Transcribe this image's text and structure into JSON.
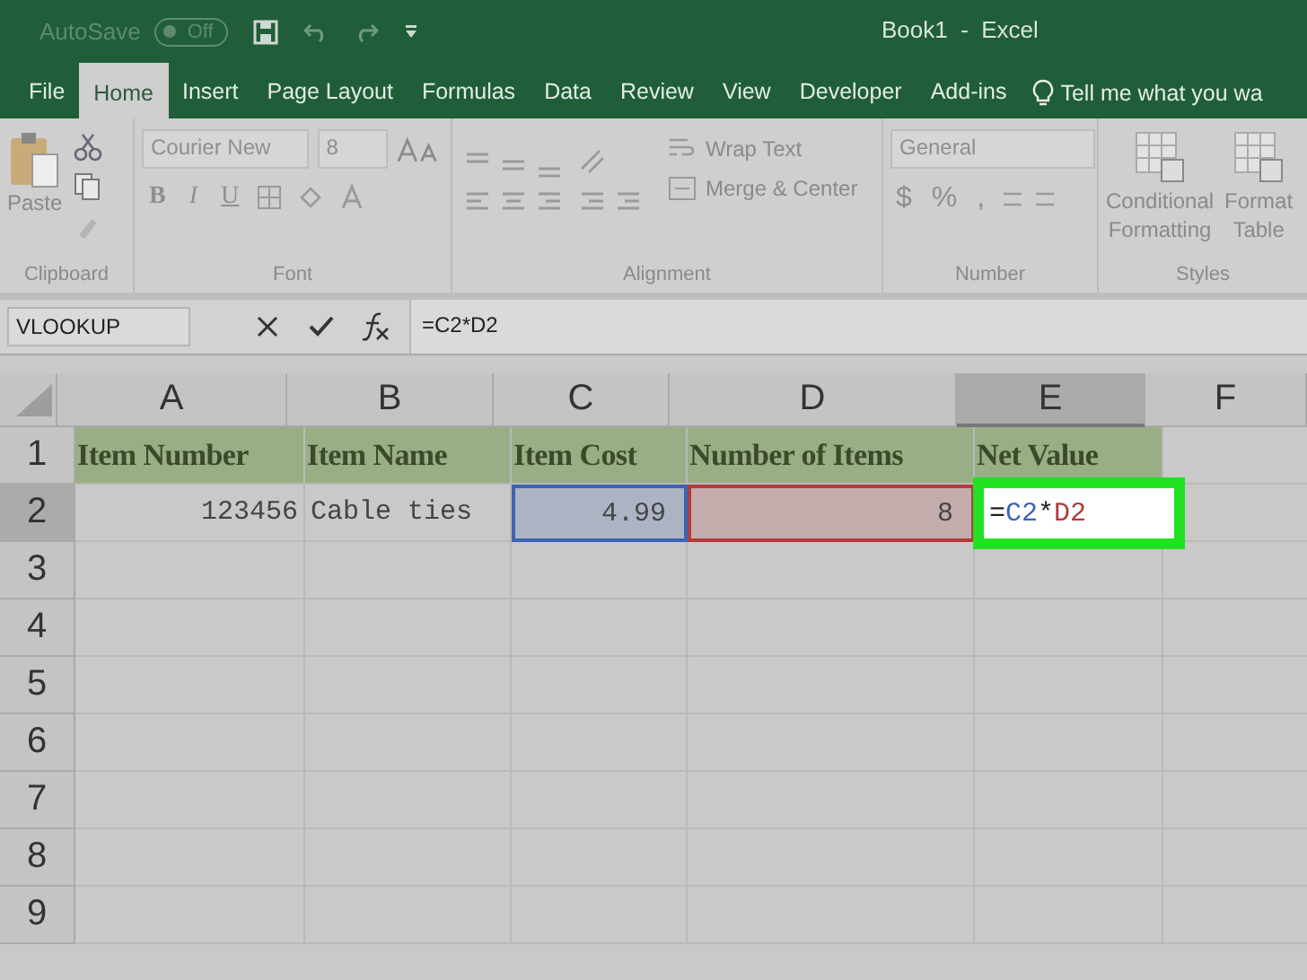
{
  "quick_access": {
    "autosave_label": "AutoSave",
    "autosave_toggle": {
      "label": "Off",
      "on": false
    }
  },
  "window": {
    "title": "Book1  -  Excel"
  },
  "tabs": [
    {
      "label": "File",
      "selected": false
    },
    {
      "label": "Home",
      "selected": true
    },
    {
      "label": "Insert",
      "selected": false
    },
    {
      "label": "Page Layout",
      "selected": false
    },
    {
      "label": "Formulas",
      "selected": false
    },
    {
      "label": "Data",
      "selected": false
    },
    {
      "label": "Review",
      "selected": false
    },
    {
      "label": "View",
      "selected": false
    },
    {
      "label": "Developer",
      "selected": false
    },
    {
      "label": "Add-ins",
      "selected": false
    }
  ],
  "tell_me": {
    "placeholder": "Tell me what you wa"
  },
  "ribbon": {
    "clipboard": {
      "paste": "Paste",
      "label": "Clipboard"
    },
    "font": {
      "name": "Courier New",
      "size": "8",
      "styles": [
        "B",
        "I",
        "U"
      ],
      "label": "Font"
    },
    "alignment": {
      "wrap": "Wrap Text",
      "merge": "Merge & Center",
      "label": "Alignment"
    },
    "number": {
      "format": "General",
      "symbols": [
        "$",
        "%",
        ","
      ],
      "label": "Number"
    },
    "styles": {
      "items": [
        {
          "lines": [
            "Conditional",
            "Formatting"
          ]
        },
        {
          "lines": [
            "Format",
            "Table"
          ]
        }
      ],
      "label": "Styles"
    }
  },
  "formula_bar": {
    "name_box": "VLOOKUP",
    "formula": "=C2*D2"
  },
  "sheet": {
    "columns": [
      {
        "label": "A",
        "selected": false
      },
      {
        "label": "B",
        "selected": false
      },
      {
        "label": "C",
        "selected": false
      },
      {
        "label": "D",
        "selected": false
      },
      {
        "label": "E",
        "selected": true
      },
      {
        "label": "F",
        "selected": false
      }
    ],
    "rows": [
      {
        "number": "1",
        "selected": false,
        "cells": [
          {
            "kind": "header",
            "text": "Item Number"
          },
          {
            "kind": "header",
            "text": "Item Name"
          },
          {
            "kind": "header",
            "text": "Item Cost"
          },
          {
            "kind": "header",
            "text": "Number of Items"
          },
          {
            "kind": "header",
            "text": "Net Value"
          },
          {
            "kind": "empty"
          }
        ]
      },
      {
        "number": "2",
        "selected": true,
        "cells": [
          {
            "kind": "number",
            "text": "123456"
          },
          {
            "kind": "text",
            "text": "Cable ties"
          },
          {
            "kind": "ref",
            "text": "4.99",
            "color": "#3b64b4"
          },
          {
            "kind": "ref",
            "text": "8",
            "color": "#b33a3a"
          },
          {
            "kind": "edit",
            "parts": [
              {
                "text": "=",
                "color": "#222222"
              },
              {
                "text": "C2",
                "color": "#3b64b4"
              },
              {
                "text": "*",
                "color": "#222222"
              },
              {
                "text": "D2",
                "color": "#b33a3a"
              }
            ]
          },
          {
            "kind": "empty"
          }
        ]
      },
      {
        "number": "3",
        "selected": false,
        "cells": []
      },
      {
        "number": "4",
        "selected": false,
        "cells": []
      },
      {
        "number": "5",
        "selected": false,
        "cells": []
      },
      {
        "number": "6",
        "selected": false,
        "cells": []
      },
      {
        "number": "7",
        "selected": false,
        "cells": []
      },
      {
        "number": "8",
        "selected": false,
        "cells": []
      },
      {
        "number": "9",
        "selected": false,
        "cells": []
      }
    ]
  }
}
